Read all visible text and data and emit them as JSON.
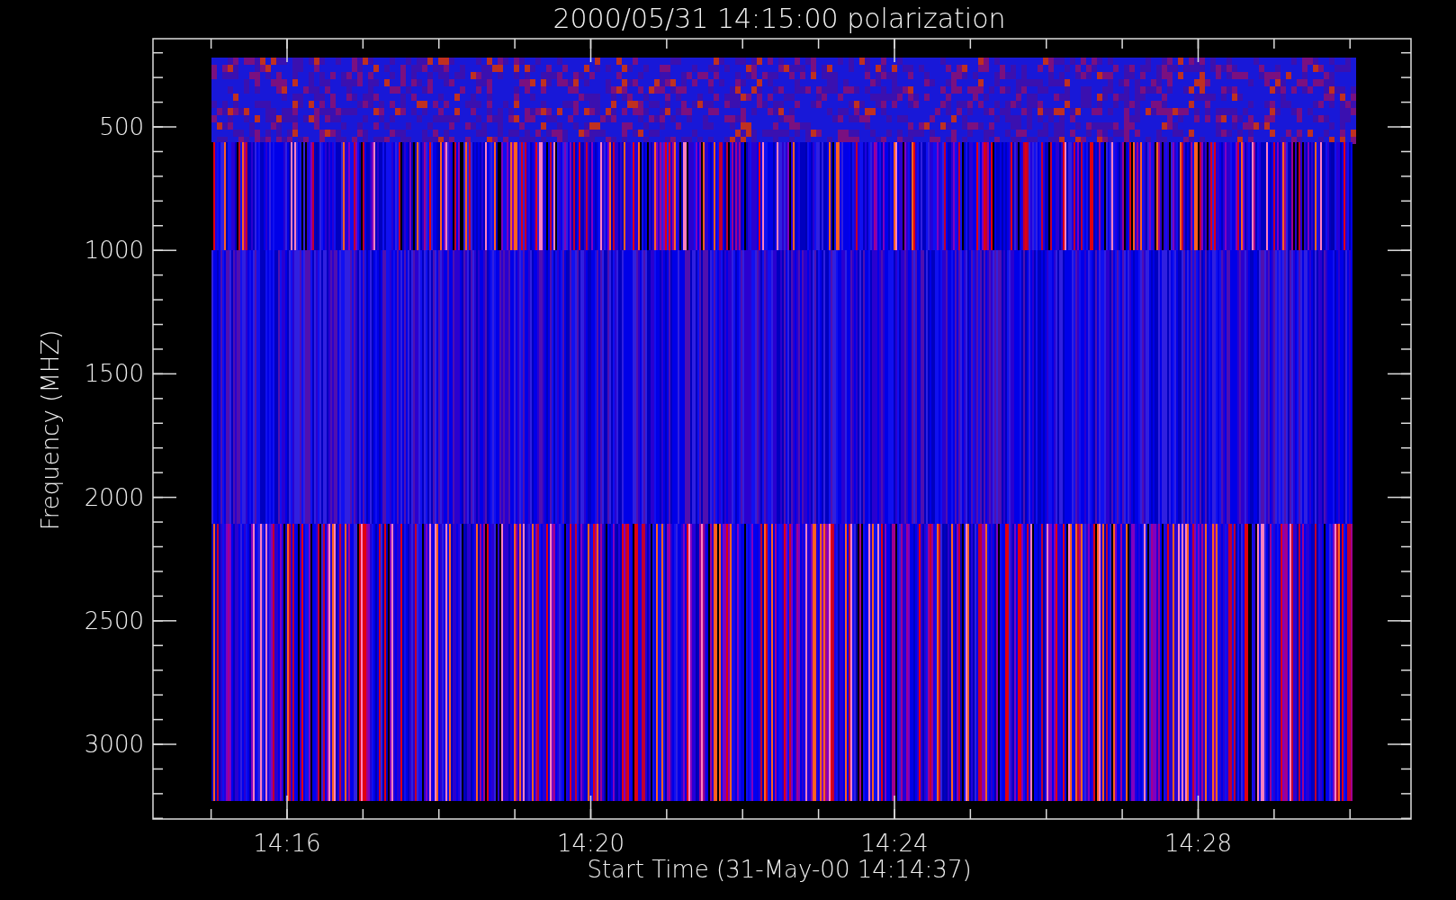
{
  "title": "2000/05/31 14:15:00 polarization",
  "y_axis": {
    "label": "Frequency (MHZ)",
    "ticks": [
      "500",
      "1000",
      "1500",
      "2000",
      "2500",
      "3000"
    ]
  },
  "x_axis": {
    "label": "Start Time (31-May-00 14:14:37)",
    "ticks": [
      "14:16",
      "14:20",
      "14:24",
      "14:28"
    ]
  }
}
